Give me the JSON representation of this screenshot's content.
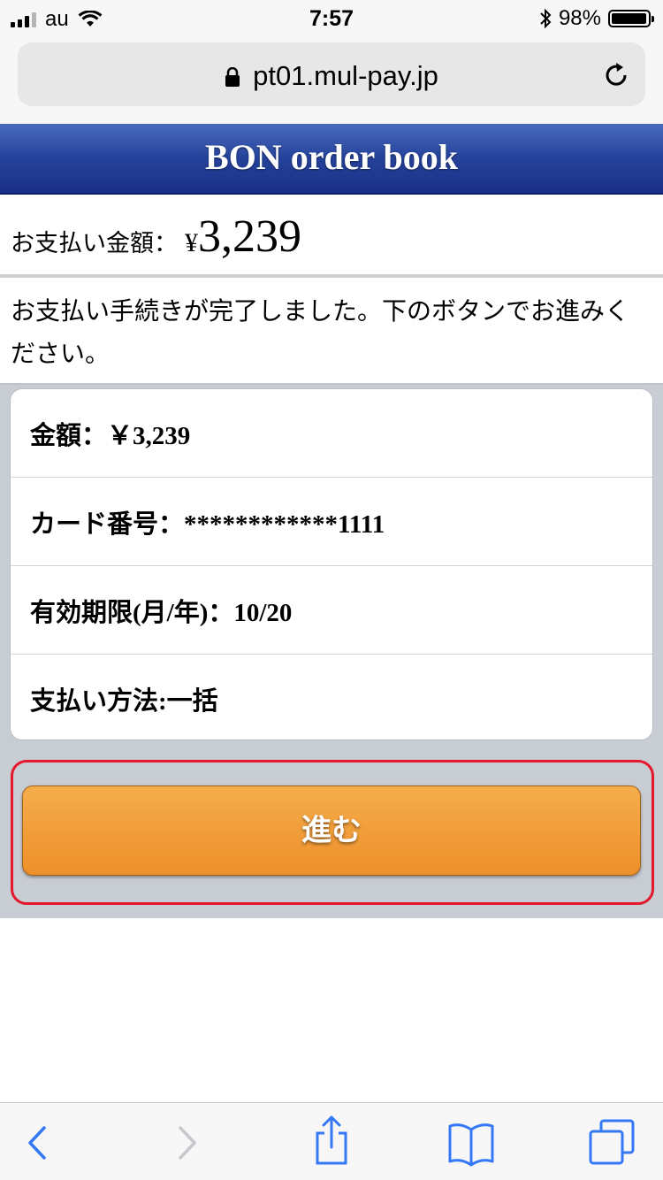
{
  "status_bar": {
    "carrier": "au",
    "time": "7:57",
    "battery": "98%",
    "battery_level": 0.98
  },
  "browser": {
    "url": "pt01.mul-pay.jp"
  },
  "header": {
    "title": "BON order book"
  },
  "payment": {
    "amount_label": "お支払い金額：",
    "currency": "¥",
    "amount": "3,239",
    "message": "お支払い手続きが完了しました。下のボタンでお進みください。"
  },
  "details": [
    {
      "text": "金額：￥3,239"
    },
    {
      "text": "カード番号：************1111"
    },
    {
      "text": "有効期限(月/年)：10/20"
    },
    {
      "text": "支払い方法:一括"
    }
  ],
  "actions": {
    "proceed_label": "進む"
  },
  "colors": {
    "header_blue": "#25429b",
    "button_orange": "#f0962e",
    "highlight_red": "#e3182a",
    "ios_blue": "#3478f6"
  }
}
